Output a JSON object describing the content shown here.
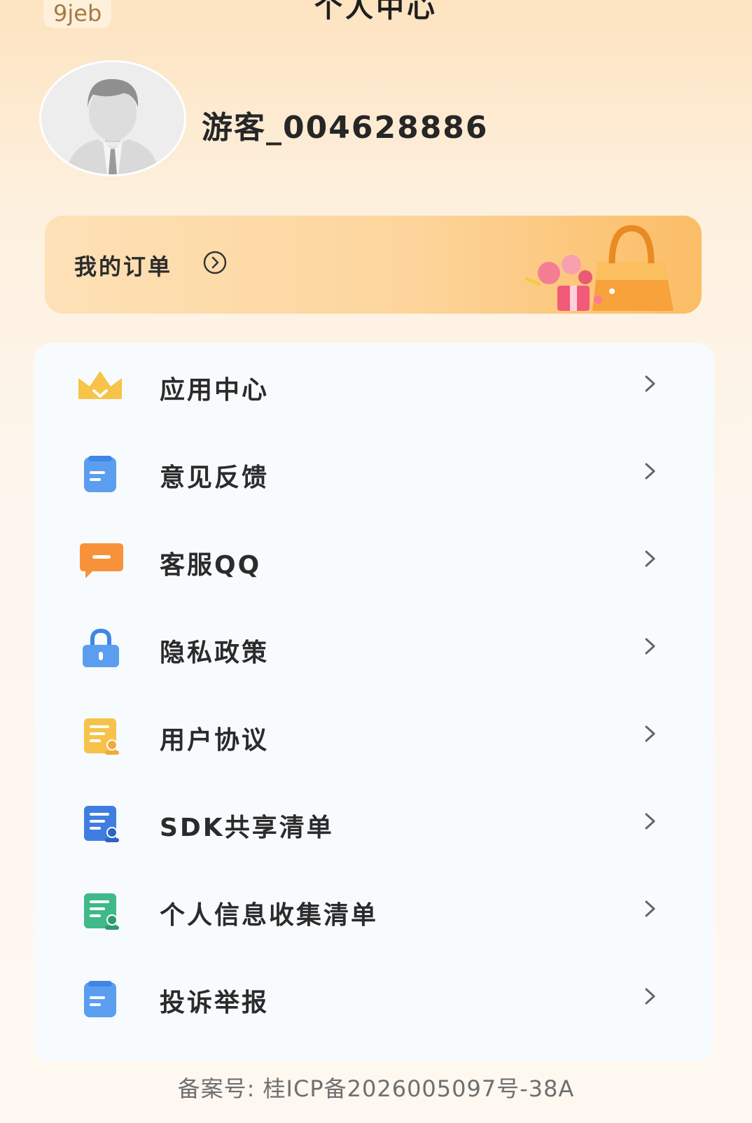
{
  "watermark": "9jeb",
  "header": {
    "title": "个人中心"
  },
  "profile": {
    "username": "游客_004628886"
  },
  "orders": {
    "label": "我的订单"
  },
  "menu": {
    "items": [
      {
        "label": "应用中心",
        "icon": "crown-icon"
      },
      {
        "label": "意见反馈",
        "icon": "feedback-icon"
      },
      {
        "label": "客服QQ",
        "icon": "chat-bubble-icon"
      },
      {
        "label": "隐私政策",
        "icon": "lock-icon"
      },
      {
        "label": "用户协议",
        "icon": "agreement-doc-icon"
      },
      {
        "label": "SDK共享清单",
        "icon": "sdk-list-icon"
      },
      {
        "label": "个人信息收集清单",
        "icon": "info-list-icon"
      },
      {
        "label": "投诉举报",
        "icon": "report-icon"
      }
    ]
  },
  "footer": {
    "icp": "备案号: 桂ICP备2026005097号-38A"
  },
  "colors": {
    "accent_orange": "#fbbd66",
    "crown": "#f7c348",
    "blue": "#5b9ef0",
    "orange": "#f7923a",
    "yellow": "#f7c24a",
    "green": "#3fb98a"
  }
}
